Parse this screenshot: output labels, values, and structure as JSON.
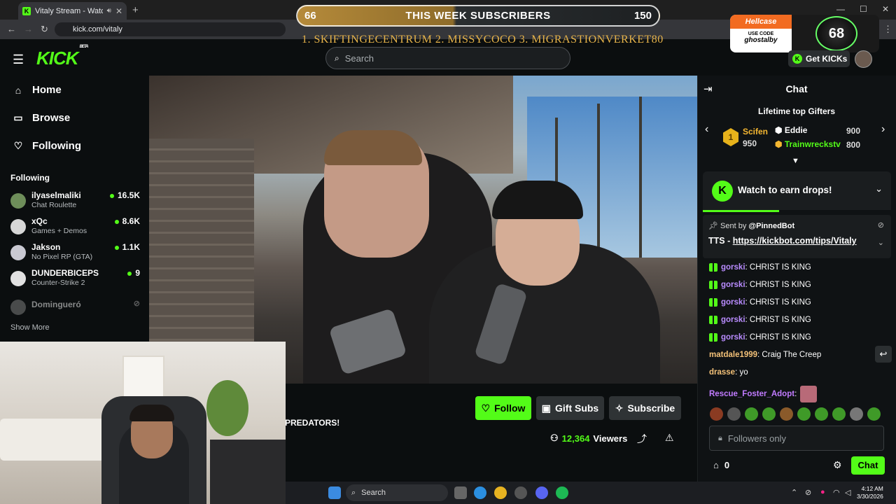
{
  "browser": {
    "tab_title": "Vitaly Stream - Watch Live",
    "url": "kick.com/vitaly",
    "new_tab": "+",
    "min": "—",
    "max": "☐",
    "close": "✕"
  },
  "overlay": {
    "sub_current": "66",
    "sub_label": "THIS WEEK SUBSCRIBERS",
    "sub_goal": "150",
    "sub_progress": 0.44,
    "ticker": "1. SKIFTINGECENTRUM   2. MISSYCOCO   3. MIGRASTIONVERKET80",
    "hellcase_brand": "Hellcase",
    "hellcase_use": "USE CODE",
    "hellcase_code": "ghostalby",
    "hellcase_badge": "68"
  },
  "header": {
    "logo": "KICK",
    "logo_beta": "BETA",
    "search_placeholder": "Search",
    "get_kicks": "Get KICKs"
  },
  "sidebar": {
    "nav": [
      {
        "label": "Home",
        "icon": "home-icon"
      },
      {
        "label": "Browse",
        "icon": "browse-icon"
      },
      {
        "label": "Following",
        "icon": "heart-icon"
      }
    ],
    "section_title": "Following",
    "following": [
      {
        "name": "ilyaselmaliki",
        "category": "Chat Roulette",
        "viewers": "16.5K"
      },
      {
        "name": "xQc",
        "category": "Games + Demos",
        "viewers": "8.6K"
      },
      {
        "name": "Jakson",
        "category": "No Pixel RP (GTA)",
        "viewers": "1.1K"
      },
      {
        "name": "DUNDERBICEPS",
        "category": "Counter-Strike 2",
        "viewers": "9"
      },
      {
        "name": "Domingueró",
        "category": "",
        "viewers": ""
      }
    ],
    "show_more": "Show More"
  },
  "stream": {
    "title_fragment": "PREDATORS!",
    "follow": "Follow",
    "gift_subs": "Gift Subs",
    "subscribe": "Subscribe",
    "viewers": "12,364",
    "viewers_label": "Viewers"
  },
  "chat": {
    "title": "Chat",
    "gifters_title": "Lifetime top Gifters",
    "gifters": [
      {
        "name": "Scifen",
        "count": "950"
      },
      {
        "name": "Eddie",
        "count": "900"
      },
      {
        "name": "Trainwreckstv",
        "count": "800"
      }
    ],
    "drops": "Watch to earn drops!",
    "pinned_sent_by": "Sent by",
    "pinned_user": "@PinnedBot",
    "pinned_msg_prefix": "TTS - ",
    "pinned_link": "https://kickbot.com/tips/Vitaly",
    "messages": [
      {
        "user": "gorski",
        "text": ": CHRIST IS KING",
        "color": "#b98cff"
      },
      {
        "user": "gorski",
        "text": ": CHRIST IS KING",
        "color": "#b98cff"
      },
      {
        "user": "gorski",
        "text": ": CHRIST IS KING",
        "color": "#b98cff"
      },
      {
        "user": "gorski",
        "text": ": CHRIST IS KING",
        "color": "#b98cff"
      },
      {
        "user": "gorski",
        "text": ": CHRIST IS KING",
        "color": "#b98cff"
      },
      {
        "user": "matdale1999",
        "text": ": Craig The Creep",
        "color": "#f3c178"
      },
      {
        "user": "drasse",
        "text": ": yo",
        "color": "#f3c178"
      },
      {
        "user": "Rescue_Foster_Adopt",
        "text": ":",
        "color": "#c17bff"
      }
    ],
    "input_placeholder": "Followers only",
    "points": "0",
    "send": "Chat"
  },
  "taskbar": {
    "search": "Search",
    "time": "4:12 AM",
    "date": "3/30/2026"
  },
  "colors": {
    "brand": "#53fc18",
    "background": "#0b0e0f"
  }
}
